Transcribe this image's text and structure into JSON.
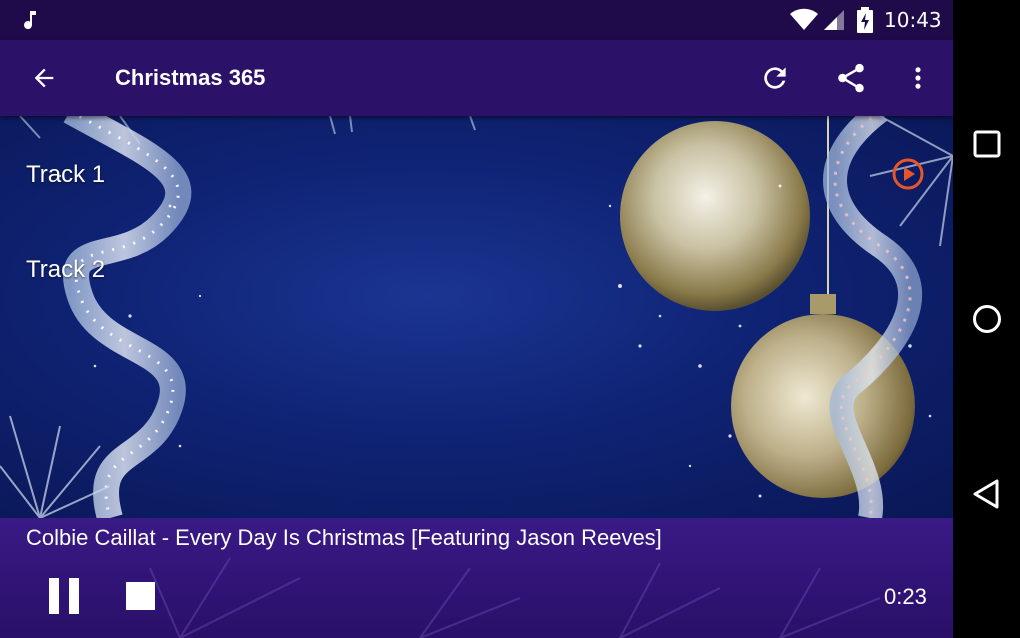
{
  "status_bar": {
    "time": "10:43",
    "icons": [
      "music-icon",
      "wifi-icon",
      "cell-signal-icon",
      "battery-charging-icon"
    ]
  },
  "toolbar": {
    "title": "Christmas 365",
    "actions": [
      "back-arrow-icon",
      "refresh-icon",
      "share-icon",
      "more-vert-icon"
    ]
  },
  "tracks": [
    {
      "label": "Track 1",
      "playing": true
    },
    {
      "label": "Track 2",
      "playing": false
    }
  ],
  "player": {
    "now_playing": "Colbie Caillat - Every Day Is Christmas [Featuring Jason Reeves]",
    "elapsed": "0:23",
    "controls": [
      "pause-icon",
      "stop-icon"
    ]
  },
  "nav_bar": {
    "buttons": [
      "recents-icon",
      "home-icon",
      "back-icon"
    ]
  },
  "colors": {
    "status_bar": "#1f0b4a",
    "toolbar": "#2b1168",
    "background": "#0f2374",
    "player_bar": "#311477",
    "playing_accent": "#e8552a"
  }
}
